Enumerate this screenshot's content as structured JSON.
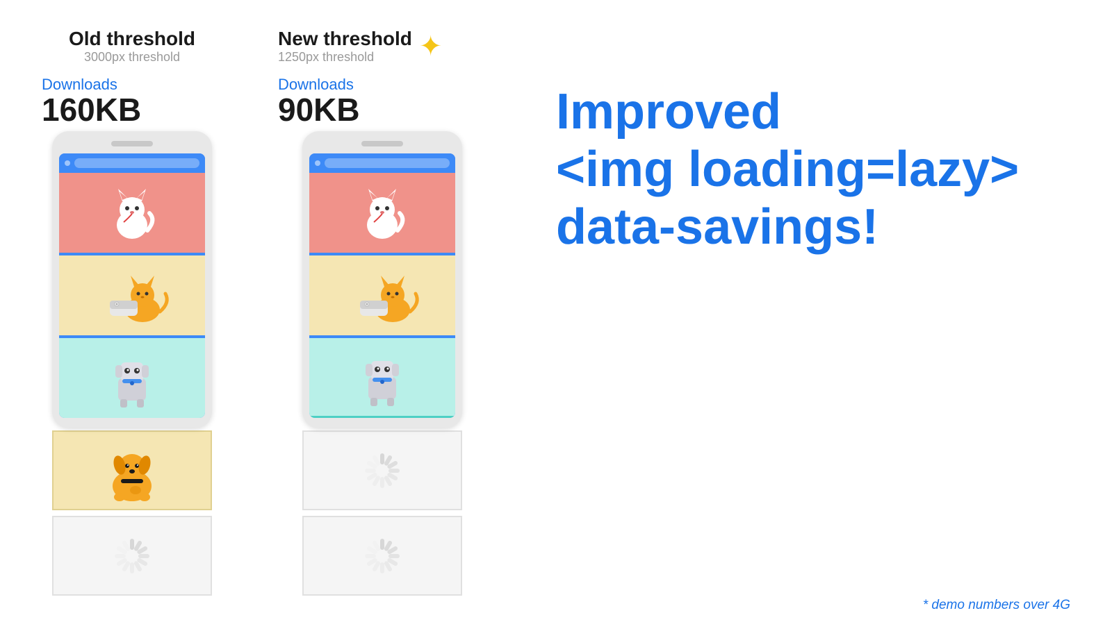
{
  "left_column": {
    "header_title": "Old threshold",
    "header_sub": "3000px threshold",
    "downloads_label": "Downloads",
    "downloads_size": "160KB"
  },
  "right_column": {
    "header_title": "New threshold",
    "header_sub": "1250px threshold",
    "downloads_label": "Downloads",
    "downloads_size": "90KB",
    "sparkle": "✦"
  },
  "main_text": {
    "line1": "Improved",
    "line2": "<img loading=lazy>",
    "line3": "data-savings!"
  },
  "demo_note": "* demo numbers over 4G",
  "colors": {
    "blue": "#1a73e8",
    "dark": "#1a1a1a",
    "gray": "#999999"
  }
}
